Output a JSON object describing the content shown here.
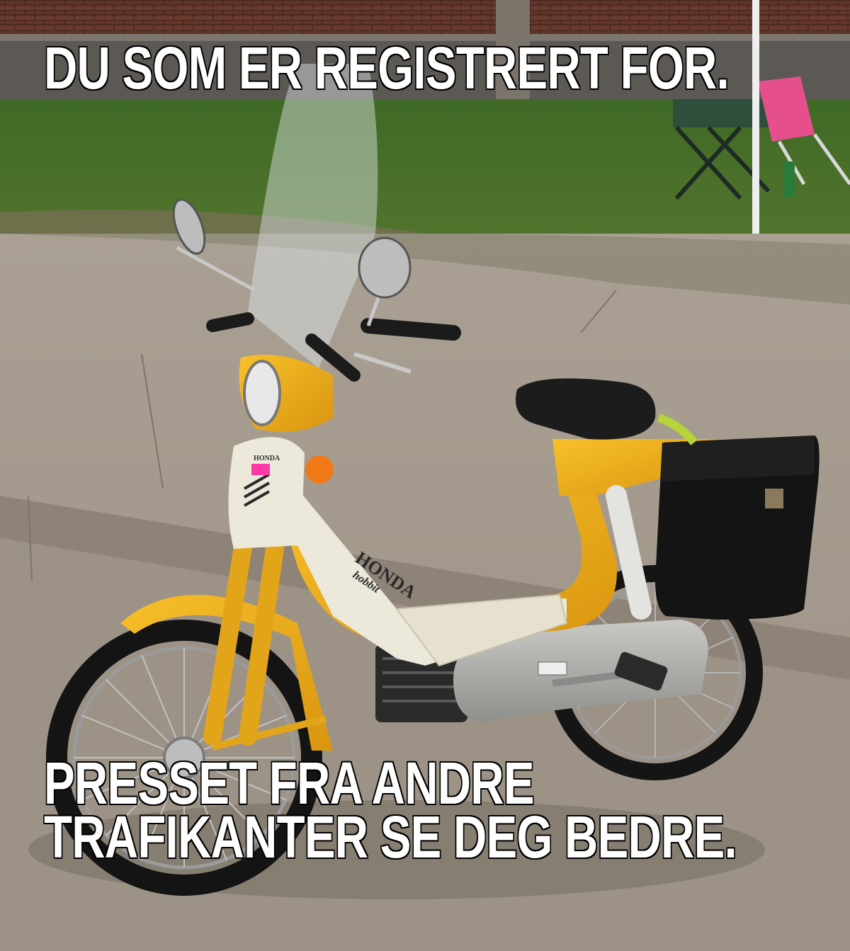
{
  "meme": {
    "top_text": "DU SOM ER REGISTRERT FOR.",
    "bottom_lines": [
      "PRESSET FRA ANDRE",
      "TRAFIKANTER SE DEG BEDRE."
    ]
  },
  "bike": {
    "brand_decal": "HONDA",
    "model_decal": "hobbit",
    "headset_badge": "HONDA",
    "body_color": "#f2b21b",
    "panel_color": "#ece8da"
  }
}
